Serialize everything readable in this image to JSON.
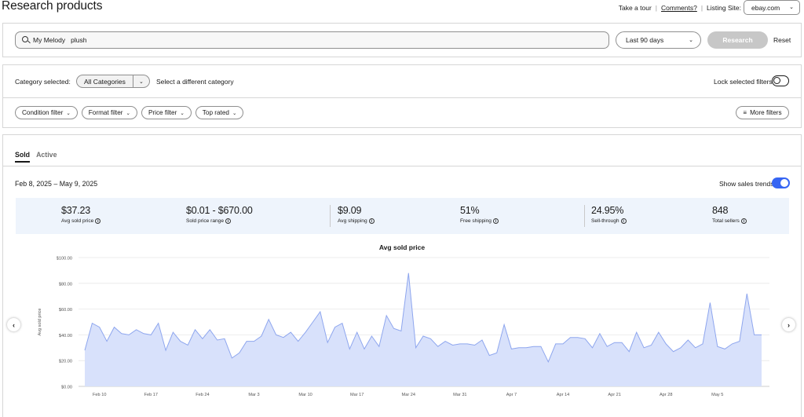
{
  "header": {
    "title": "Research products",
    "take_tour": "Take a tour",
    "comments": "Comments?",
    "listing_site_label": "Listing Site:",
    "listing_site_value": "ebay.com"
  },
  "search": {
    "query": "My Melody   plush",
    "range": "Last 90 days",
    "research_label": "Research",
    "reset_label": "Reset"
  },
  "filters": {
    "category_label": "Category selected:",
    "category_value": "All Categories",
    "change_category": "Select a different category",
    "lock_label": "Lock selected filters",
    "lock_on": false,
    "chips": [
      "Condition filter",
      "Format filter",
      "Price filter",
      "Top rated"
    ],
    "more_filters": "More filters"
  },
  "results": {
    "tabs": {
      "sold": "Sold",
      "active": "Active"
    },
    "selected_tab": "Sold",
    "date_range": "Feb 8, 2025 – May 9, 2025",
    "sales_trends_label": "Show sales trends",
    "sales_trends_on": true,
    "stats": [
      {
        "value": "$37.23",
        "label": "Avg sold price"
      },
      {
        "value": "$0.01 - $670.00",
        "label": "Sold price range"
      },
      {
        "value": "$9.09",
        "label": "Avg shipping"
      },
      {
        "value": "51%",
        "label": "Free shipping"
      },
      {
        "value": "24.95%",
        "label": "Sell-through"
      },
      {
        "value": "848",
        "label": "Total sellers"
      }
    ]
  },
  "colors": {
    "accent": "#3665f3",
    "area_fill": "#d8e1fb",
    "area_line": "#8ea6ee",
    "stats_bg": "#eef4fc"
  },
  "chart_data": {
    "type": "area",
    "title": "Avg sold price",
    "ylabel": "Avg sold price",
    "xlabel": "",
    "ylim": [
      0,
      100
    ],
    "y_ticks": [
      "$0.00",
      "$20.00",
      "$40.00",
      "$60.00",
      "$80.00",
      "$100.00"
    ],
    "x_ticks": [
      "Feb 10",
      "Feb 17",
      "Feb 24",
      "Mar 3",
      "Mar 10",
      "Mar 17",
      "Mar 24",
      "Mar 31",
      "Apr 7",
      "Apr 14",
      "Apr 21",
      "Apr 28",
      "May 5"
    ],
    "x_tick_day_index": [
      2,
      9,
      16,
      23,
      30,
      37,
      44,
      51,
      58,
      65,
      72,
      79,
      86
    ],
    "x_start": "Feb 8",
    "grid": true,
    "series": [
      {
        "values": [
          28,
          49,
          46,
          35,
          46,
          41,
          40,
          44,
          41,
          40,
          49,
          28,
          42,
          35,
          32,
          44,
          37,
          44,
          36,
          37,
          22,
          26,
          35,
          35,
          39,
          52,
          40,
          38,
          42,
          35,
          42,
          50,
          58,
          34,
          46,
          49,
          29,
          42,
          29,
          39,
          31,
          55,
          45,
          43,
          88,
          30,
          39,
          37,
          31,
          35,
          32,
          33,
          33,
          32,
          36,
          24,
          26,
          48,
          29,
          30,
          30,
          31,
          31,
          19,
          33,
          33,
          38,
          38,
          37,
          30,
          41,
          31,
          34,
          34,
          27,
          42,
          30,
          32,
          42,
          33,
          27,
          30,
          36,
          30,
          33,
          65,
          31,
          29,
          33,
          35,
          72,
          40,
          40
        ]
      }
    ]
  }
}
